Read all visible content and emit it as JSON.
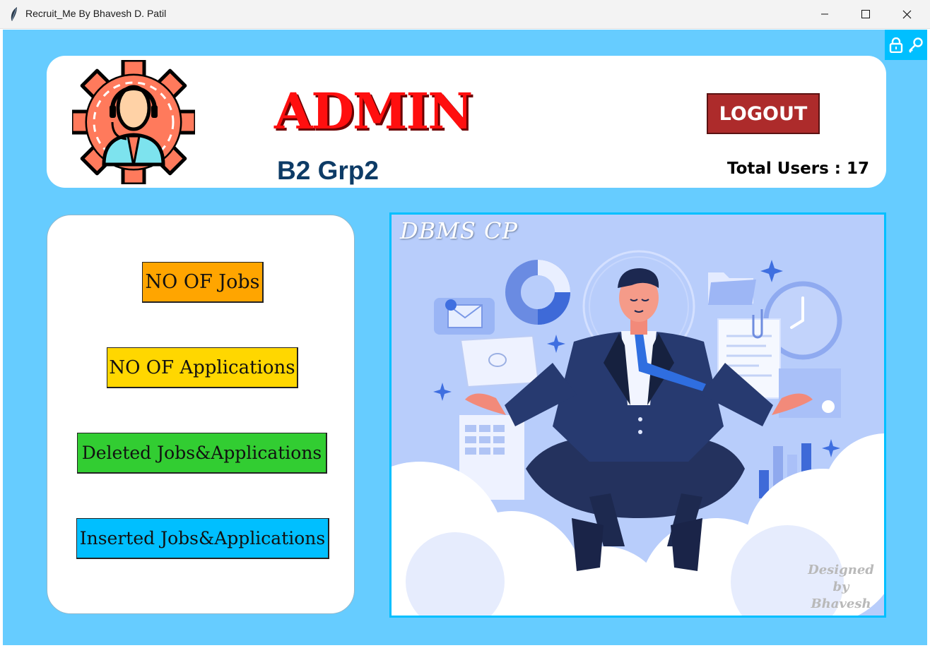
{
  "window": {
    "title": "Recruit_Me By Bhavesh D. Patil",
    "controls": [
      "minimize-icon",
      "maximize-icon",
      "close-icon"
    ]
  },
  "header": {
    "title": "ADMIN",
    "group": "B2 Grp2",
    "logout_label": "LOGOUT",
    "total_users_text": "Total Users : 17",
    "total_users_count": 17
  },
  "menu": {
    "buttons": [
      {
        "label": "NO OF Jobs",
        "color": "#ffa500"
      },
      {
        "label": "NO OF Applications",
        "color": "#ffd700"
      },
      {
        "label": "Deleted Jobs&Applications",
        "color": "#32cd32"
      },
      {
        "label": "Inserted Jobs&Applications",
        "color": "#00bfff"
      }
    ]
  },
  "illustration": {
    "watermark_top": "DBMS CP",
    "watermark_bottom_line1": "Designed by",
    "watermark_bottom_line2": "Bhavesh"
  },
  "colors": {
    "background": "#66ccff",
    "accent": "#00bfff",
    "admin_title": "#ff0f0f",
    "group_text": "#0d3b66",
    "logout": "#ad2b2b"
  }
}
